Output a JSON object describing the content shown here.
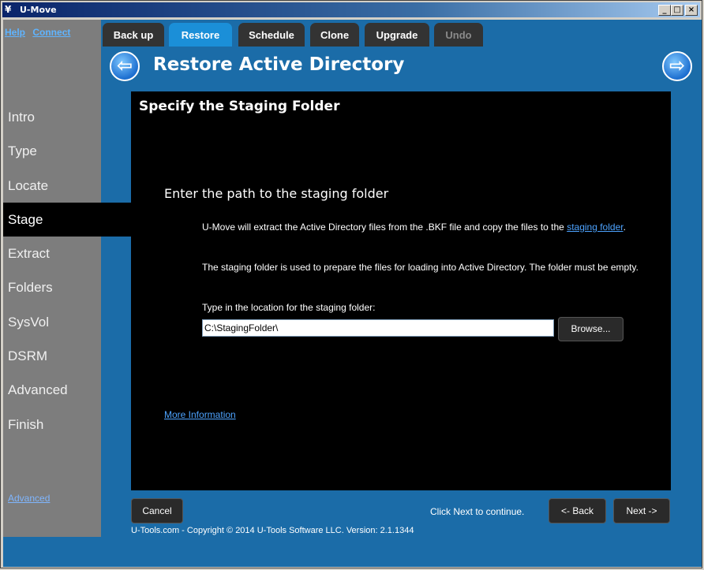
{
  "window": {
    "title": "U-Move",
    "controls": [
      "_",
      "□",
      "×"
    ]
  },
  "toplinks": {
    "help": "Help",
    "connect": "Connect"
  },
  "tabs": [
    {
      "label": "Back up"
    },
    {
      "label": "Restore"
    },
    {
      "label": "Schedule"
    },
    {
      "label": "Clone"
    },
    {
      "label": "Upgrade"
    },
    {
      "label": "Undo"
    }
  ],
  "page": {
    "title": "Restore Active Directory",
    "back_arrow": "⇦",
    "forward_arrow": "⇨"
  },
  "sidebar": {
    "items": [
      {
        "label": "Intro"
      },
      {
        "label": "Type"
      },
      {
        "label": "Locate"
      },
      {
        "label": "Stage"
      },
      {
        "label": "Extract"
      },
      {
        "label": "Folders"
      },
      {
        "label": "SysVol"
      },
      {
        "label": "DSRM"
      },
      {
        "label": "Advanced"
      },
      {
        "label": "Finish"
      }
    ],
    "active": "Stage",
    "advanced_link": "Advanced"
  },
  "panel": {
    "title": "Specify the Staging Folder",
    "section_heading": "Enter the path to the staging folder",
    "para1_text": "U-Move will extract the Active Directory files from the .BKF file and copy the files to the ",
    "para1_link": "staging folder",
    "para1_end": ".",
    "para2": "The staging folder is used to prepare the files for loading into Active Directory. The folder must be empty.",
    "input_label": "Type in the location for the staging folder:",
    "input_value": "C:\\StagingFolder\\",
    "browse_label": "Browse...",
    "more_info": "More Information"
  },
  "bottom": {
    "cancel": "Cancel",
    "hint": "Click Next to continue.",
    "back": "<- Back",
    "next": "Next ->",
    "footer": "U-Tools.com - Copyright © 2014 U-Tools Software LLC.    Version: 2.1.1344"
  }
}
